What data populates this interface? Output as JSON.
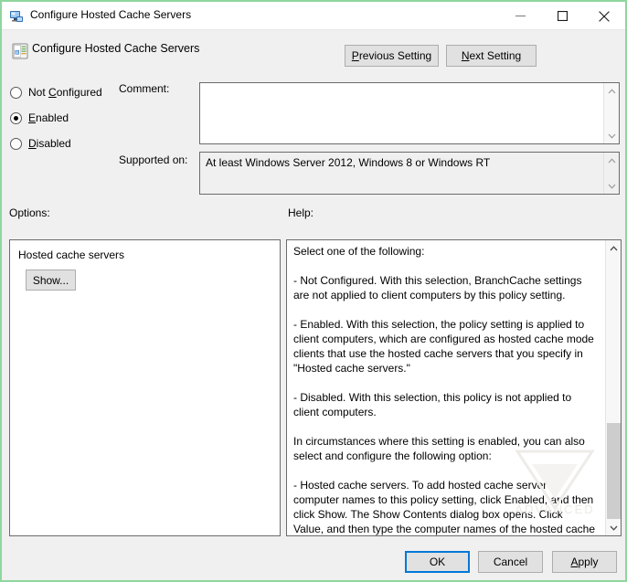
{
  "window": {
    "title": "Configure Hosted Cache Servers",
    "titlebar_icon": "computer-monitor-icon",
    "minimize_label": "—",
    "maximize_label": "□",
    "close_label": "✕"
  },
  "header": {
    "icon": "policy-setting-icon",
    "title": "Configure Hosted Cache Servers",
    "previous_setting": "Previous Setting",
    "previous_accel": "P",
    "next_setting": "Next Setting",
    "next_accel": "N"
  },
  "state": {
    "options": [
      {
        "label": "Not Configured",
        "accel": "C",
        "selected": false
      },
      {
        "label": "Enabled",
        "accel": "E",
        "selected": true
      },
      {
        "label": "Disabled",
        "accel": "D",
        "selected": false
      }
    ]
  },
  "comment": {
    "label": "Comment:",
    "value": "",
    "placeholder": ""
  },
  "supported_on": {
    "label": "Supported on:",
    "value": "At least Windows Server 2012, Windows 8 or Windows RT"
  },
  "options_section": {
    "label": "Options:",
    "setting_label": "Hosted cache servers",
    "show_button": "Show..."
  },
  "help_section": {
    "label": "Help:",
    "text": "Select one of the following:\n\n- Not Configured. With this selection, BranchCache settings are not applied to client computers by this policy setting.\n\n- Enabled. With this selection, the policy setting is applied to client computers, which are configured as hosted cache mode clients that use the hosted cache servers that you specify in \"Hosted cache servers.\"\n\n- Disabled. With this selection, this policy is not applied to client computers.\n\nIn circumstances where this setting is enabled, you can also select and configure the following option:\n\n- Hosted cache servers. To add hosted cache server computer names to this policy setting, click Enabled, and then click Show. The Show Contents dialog box opens. Click Value, and then type the computer names of the hosted cache servers."
  },
  "footer": {
    "ok": "OK",
    "cancel": "Cancel",
    "apply": "Apply",
    "apply_accel": "A"
  },
  "watermark": {
    "text": "ADVANCED"
  },
  "colors": {
    "window_border": "#8fd69f",
    "dialog_background": "#f0f0f0",
    "button_face": "#e1e1e1",
    "button_border": "#adadad",
    "focus_accent": "#0078d7",
    "field_border": "#6b6b6b"
  }
}
